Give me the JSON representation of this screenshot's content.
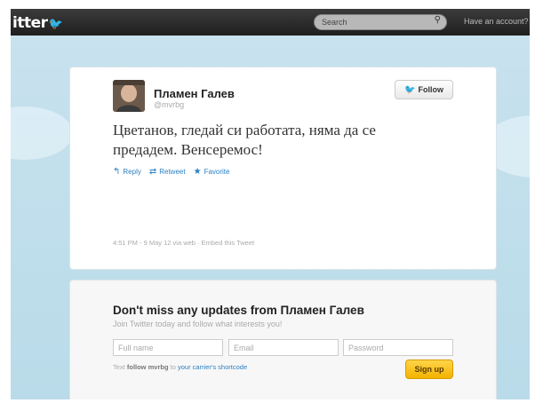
{
  "header": {
    "logo_text": "itter",
    "search_placeholder": "Search",
    "account_text": "Have an account?"
  },
  "tweet": {
    "author_name": "Пламен Галев",
    "author_handle": "@mvrbg",
    "follow_label": "Follow",
    "text": "Цветанов, гледай си работата, няма да се предадем. Венсеремос!",
    "actions": {
      "reply": "Reply",
      "retweet": "Retweet",
      "favorite": "Favorite"
    },
    "meta": "4:51 PM - 9 May 12 via web · Embed this Tweet"
  },
  "signup": {
    "title": "Don't miss any updates from Пламен Галев",
    "subtitle": "Join Twitter today and follow what interests you!",
    "fullname_placeholder": "Full name",
    "email_placeholder": "Email",
    "password_placeholder": "Password",
    "text_prefix": "Text",
    "text_command": "follow mvrbg",
    "text_middle": "to",
    "shortcode_link": "your carrier's shortcode",
    "button_label": "Sign up"
  },
  "colors": {
    "accent": "#2a7fc2",
    "signup_button": "#f3b300",
    "topbar": "#2a2a2a"
  }
}
